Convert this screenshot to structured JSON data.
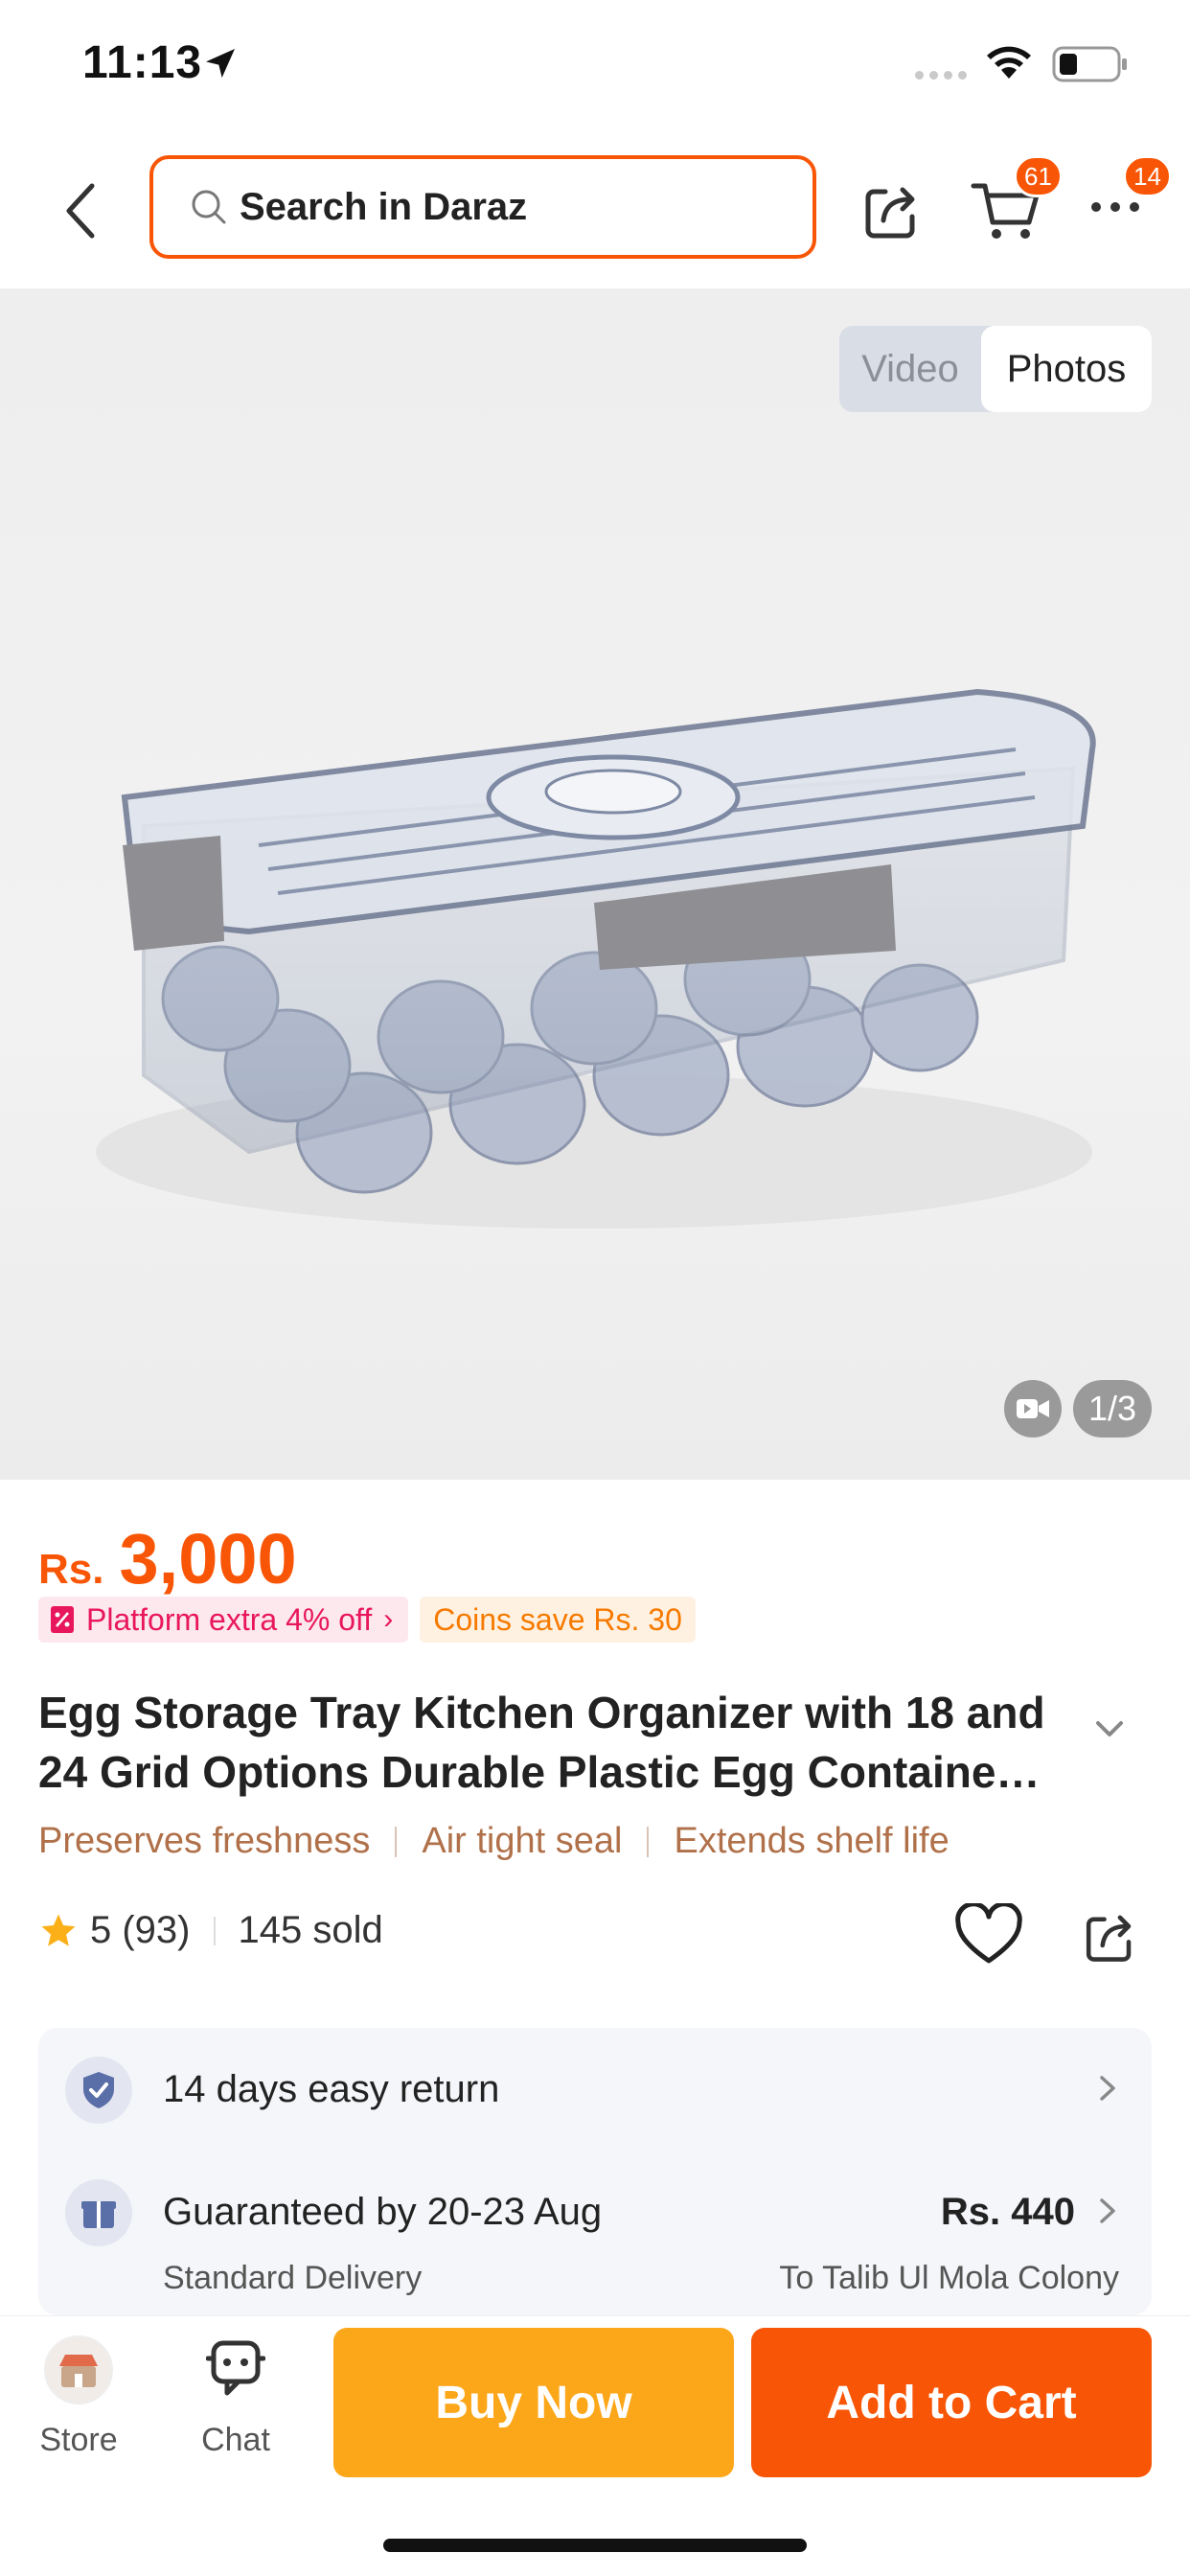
{
  "status_bar": {
    "time": "11:13"
  },
  "nav": {
    "search_placeholder": "Search in Daraz",
    "cart_badge": "61",
    "more_badge": "14"
  },
  "gallery": {
    "toggle_video": "Video",
    "toggle_photos": "Photos",
    "selected_tab": "Photos",
    "page_indicator": "1/3"
  },
  "product": {
    "currency": "Rs.",
    "price": "3,000",
    "promo_platform": "Platform extra 4% off",
    "promo_coins": "Coins save Rs. 30",
    "title": "Egg Storage Tray Kitchen Organizer with 18 and 24 Grid Options Durable Plastic Egg Containe…",
    "features": [
      "Preserves freshness",
      "Air tight seal",
      "Extends shelf life"
    ],
    "rating": "5 (93)",
    "sold": "145 sold"
  },
  "info": {
    "return_text": "14 days easy return",
    "delivery_text": "Guaranteed by 20-23 Aug",
    "delivery_price": "Rs. 440",
    "delivery_type": "Standard Delivery",
    "delivery_to": "To Talib Ul Mola Colony"
  },
  "bottom_bar": {
    "store_label": "Store",
    "chat_label": "Chat",
    "buy_now_label": "Buy Now",
    "add_to_cart_label": "Add to Cart"
  },
  "colors": {
    "brand_orange": "#f85606",
    "buy_now_yellow": "#fca71a",
    "promo_pink": "#e8175d",
    "coins_orange": "#f77a00",
    "feature_brown": "#b0714a"
  },
  "icons": [
    "location-arrow-icon",
    "wifi-icon",
    "battery-icon",
    "back-arrow-icon",
    "search-icon",
    "share-icon",
    "cart-icon",
    "more-icon",
    "video-camera-icon",
    "tag-icon",
    "chevron-right-icon",
    "chevron-down-icon",
    "star-icon",
    "heart-icon",
    "shield-check-icon",
    "gift-icon",
    "store-icon",
    "chat-icon"
  ]
}
